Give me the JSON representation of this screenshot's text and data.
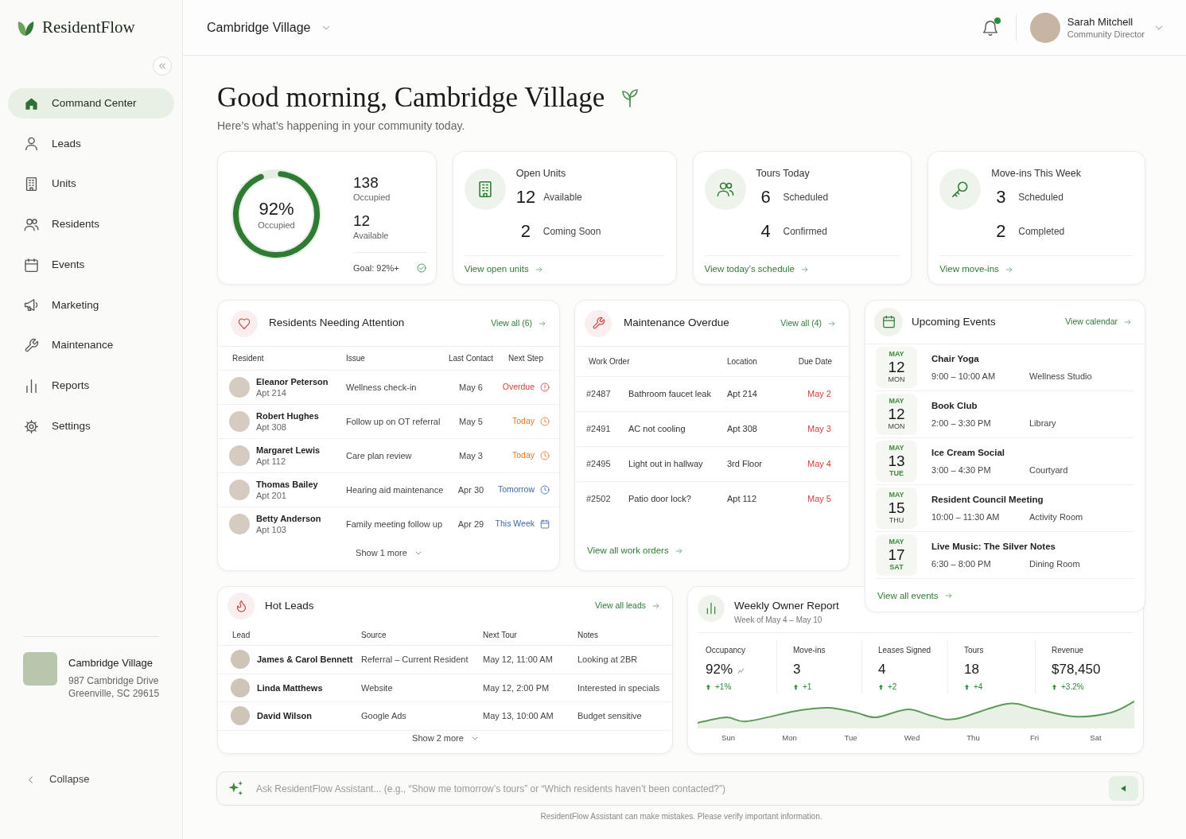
{
  "app": {
    "name": "ResidentFlow"
  },
  "sidebar": {
    "items": [
      {
        "label": "Command Center",
        "selected": true
      },
      {
        "label": "Leads",
        "selected": false
      },
      {
        "label": "Units",
        "selected": false
      },
      {
        "label": "Residents",
        "selected": false
      },
      {
        "label": "Events",
        "selected": false
      },
      {
        "label": "Marketing",
        "selected": false
      },
      {
        "label": "Maintenance",
        "selected": false
      },
      {
        "label": "Reports",
        "selected": false
      },
      {
        "label": "Settings",
        "selected": false
      }
    ],
    "community": {
      "name": "Cambridge Village",
      "address_lines": [
        "987 Cambridge Drive",
        "Greenville, SC 29615"
      ]
    },
    "collapse_label": "Collapse"
  },
  "header": {
    "community_selector": "Cambridge Village",
    "notifications": {
      "unread": true
    },
    "user": {
      "name": "Sarah Mitchell",
      "role": "Community Director"
    }
  },
  "greeting": {
    "title": "Good morning, Cambridge Village",
    "subtitle": "Here’s what’s happening in your community today."
  },
  "occupancy_card": {
    "percent": "92%",
    "caption": "Occupied",
    "level": 0.92,
    "stats": [
      {
        "value": "138",
        "label": "Occupied"
      },
      {
        "value": "12",
        "label": "Available"
      }
    ],
    "goal": "Goal: 92%+",
    "goal_met": true
  },
  "stat_cards": [
    {
      "title": "Open Units",
      "rows": [
        {
          "value": "12",
          "label": "Available"
        },
        {
          "value": "2",
          "label": "Coming Soon"
        }
      ],
      "link": "View open units"
    },
    {
      "title": "Tours Today",
      "rows": [
        {
          "value": "6",
          "label": "Scheduled"
        },
        {
          "value": "4",
          "label": "Confirmed"
        }
      ],
      "link": "View today’s schedule"
    },
    {
      "title": "Move-ins This Week",
      "rows": [
        {
          "value": "3",
          "label": "Scheduled"
        },
        {
          "value": "2",
          "label": "Completed"
        }
      ],
      "link": "View move-ins"
    }
  ],
  "residents_attention": {
    "title": "Residents Needing Attention",
    "link": "View all (6)",
    "columns": [
      "Resident",
      "Issue",
      "Last Contact",
      "Next Step"
    ],
    "rows": [
      {
        "name": "Eleanor Peterson",
        "unit": "Apt 214",
        "issue": "Wellness check-in",
        "last_contact": "May 6",
        "next_step": "Overdue",
        "kind": "overdue"
      },
      {
        "name": "Robert Hughes",
        "unit": "Apt 308",
        "issue": "Follow up on OT referral",
        "last_contact": "May 5",
        "next_step": "Today",
        "kind": "today"
      },
      {
        "name": "Margaret Lewis",
        "unit": "Apt 112",
        "issue": "Care plan review",
        "last_contact": "May 3",
        "next_step": "Today",
        "kind": "today"
      },
      {
        "name": "Thomas Bailey",
        "unit": "Apt 201",
        "issue": "Hearing aid maintenance",
        "last_contact": "Apr 30",
        "next_step": "Tomorrow",
        "kind": "tomorrow"
      },
      {
        "name": "Betty Anderson",
        "unit": "Apt 103",
        "issue": "Family meeting follow up",
        "last_contact": "Apr 29",
        "next_step": "This Week",
        "kind": "this_week"
      }
    ],
    "show_more": "Show 1 more"
  },
  "maintenance_overdue": {
    "title": "Maintenance Overdue",
    "link": "View all (4)",
    "columns": [
      "Work Order",
      "Location",
      "Due Date"
    ],
    "rows": [
      {
        "id": "#2487",
        "issue": "Bathroom faucet leak",
        "location": "Apt 214",
        "due": "May 2"
      },
      {
        "id": "#2491",
        "issue": "AC not cooling",
        "location": "Apt 308",
        "due": "May 3"
      },
      {
        "id": "#2495",
        "issue": "Light out in hallway",
        "location": "3rd Floor",
        "due": "May 4"
      },
      {
        "id": "#2502",
        "issue": "Patio door lock?",
        "location": "Apt 112",
        "due": "May 5"
      }
    ],
    "footer_link": "View all work orders"
  },
  "upcoming_events": {
    "title": "Upcoming Events",
    "link": "View calendar",
    "items": [
      {
        "month": "MAY",
        "day": "12",
        "weekday": "MON",
        "highlighted": false,
        "title": "Chair Yoga",
        "time": "9:00 – 10:00 AM",
        "location": "Wellness Studio"
      },
      {
        "month": "MAY",
        "day": "12",
        "weekday": "MON",
        "highlighted": false,
        "title": "Book Club",
        "time": "2:00 – 3:30 PM",
        "location": "Library"
      },
      {
        "month": "MAY",
        "day": "13",
        "weekday": "TUE",
        "highlighted": true,
        "title": "Ice Cream Social",
        "time": "3:00 – 4:30 PM",
        "location": "Courtyard"
      },
      {
        "month": "MAY",
        "day": "15",
        "weekday": "THU",
        "highlighted": false,
        "title": "Resident Council Meeting",
        "time": "10:00 – 11:30 AM",
        "location": "Activity Room"
      },
      {
        "month": "MAY",
        "day": "17",
        "weekday": "SAT",
        "highlighted": true,
        "title": "Live Music: The Silver Notes",
        "time": "6:30 – 8:00 PM",
        "location": "Dining Room"
      }
    ],
    "footer_link": "View all events"
  },
  "hot_leads": {
    "title": "Hot Leads",
    "link": "View all leads",
    "columns": [
      "Lead",
      "Source",
      "Next Tour",
      "Notes"
    ],
    "rows": [
      {
        "name": "James & Carol Bennett",
        "source": "Referral – Current Resident",
        "next_tour": "May 12, 11:00 AM",
        "notes": "Looking at 2BR"
      },
      {
        "name": "Linda Matthews",
        "source": "Website",
        "next_tour": "May 12, 2:00 PM",
        "notes": "Interested in specials"
      },
      {
        "name": "David Wilson",
        "source": "Google Ads",
        "next_tour": "May 13, 10:00 AM",
        "notes": "Budget sensitive"
      }
    ],
    "show_more": "Show 2 more"
  },
  "weekly_report": {
    "title": "Weekly Owner Report",
    "subtitle": "Week of May 4 – May 10",
    "metrics": [
      {
        "label": "Occupancy",
        "value": "92%",
        "change": "+1%"
      },
      {
        "label": "Move-ins",
        "value": "3",
        "change": "+1"
      },
      {
        "label": "Leases Signed",
        "value": "4",
        "change": "+2"
      },
      {
        "label": "Tours",
        "value": "18",
        "change": "+4"
      },
      {
        "label": "Revenue",
        "value": "$78,450",
        "change": "+3.2%"
      }
    ],
    "days": [
      "Sun",
      "Mon",
      "Tue",
      "Wed",
      "Thu",
      "Fri",
      "Sat"
    ]
  },
  "assistant": {
    "placeholder": "Ask ResidentFlow Assistant... (e.g., “Show me tomorrow’s tours” or “Which residents haven’t been contacted?”)",
    "disclaimer": "ResidentFlow Assistant can make mistakes. Please verify important information."
  }
}
